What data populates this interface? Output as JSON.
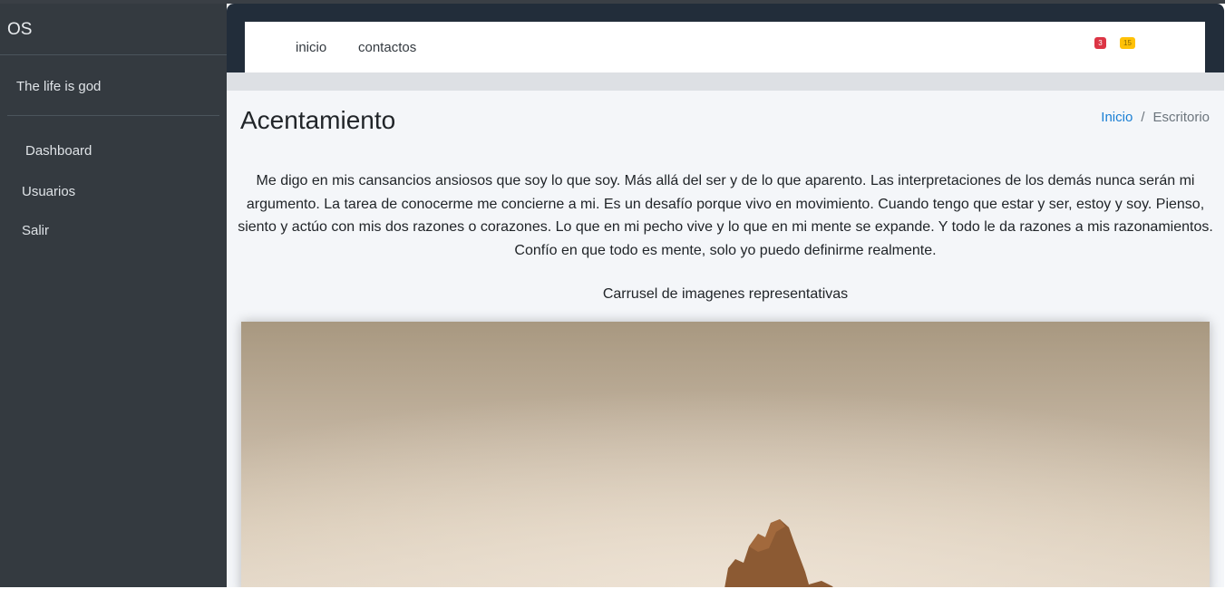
{
  "sidebar": {
    "brand": "OS",
    "user_name": "The life is god",
    "items": [
      {
        "label": "Dashboard"
      },
      {
        "label": "Usuarios"
      },
      {
        "label": "Salir"
      }
    ]
  },
  "navbar": {
    "links": [
      {
        "label": "inicio"
      },
      {
        "label": "contactos"
      }
    ],
    "badges": {
      "red": "3",
      "yellow": "15"
    }
  },
  "content": {
    "title": "Acentamiento",
    "breadcrumb": {
      "home": "Inicio",
      "separator": "/",
      "current": "Escritorio"
    },
    "intro_text": "Me digo en mis cansancios ansiosos que soy lo que soy. Más allá del ser y de lo que aparento. Las interpretaciones de los demás nunca serán mi argumento. La tarea de conocerme me concierne a mi. Es un desafío porque vivo en movimiento. Cuando tengo que estar y ser, estoy y soy. Pienso, siento y actúo con mis dos razones o corazones. Lo que en mi pecho vive y lo que en mi mente se expande. Y todo le da razones a mis razonamientos. Confío en que todo es mente, solo yo puedo definirme realmente.",
    "carousel_caption": "Carrusel de imagenes representativas"
  },
  "colors": {
    "sidebar_bg": "#343a40",
    "header_bg": "#222d3a",
    "content_bg": "#f4f6f9",
    "link_blue": "#1a7fd4",
    "badge_red": "#dc3545",
    "badge_yellow": "#ffc107"
  }
}
